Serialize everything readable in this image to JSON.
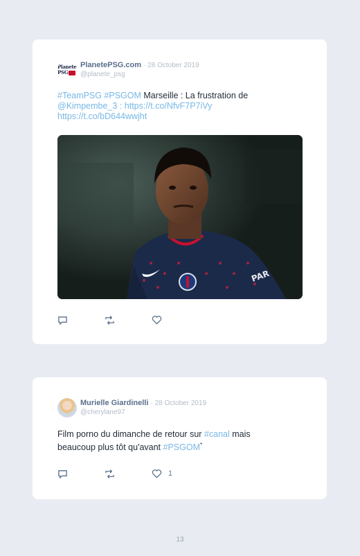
{
  "tweets": [
    {
      "name": "PlanetePSG.com",
      "date": "· 28 October 2019",
      "handle": "@planete_psg",
      "avatar_logo_text": [
        "Planete",
        "PSG"
      ],
      "text_segments": [
        {
          "text": "#TeamPSG",
          "link": true
        },
        {
          "text": " ",
          "link": false
        },
        {
          "text": "#PSGOM",
          "link": true
        },
        {
          "text": " Marseille : La frustration de ",
          "link": false
        },
        {
          "text": "@Kimpembe_3",
          "link": true
        },
        {
          "text": " : ",
          "link": false
        },
        {
          "text": "https://t.co/NfvF7P7iVy",
          "link": true
        },
        {
          "text": " ",
          "link": false
        },
        {
          "text": "https://t.co/bD644wwjht",
          "link": true
        }
      ],
      "has_media": true,
      "media_alt_text_visible": "PAR",
      "like_count": ""
    },
    {
      "name": "Murielle Giardinelli",
      "date": "· 28 October 2019",
      "handle": "@cherylane97",
      "text_segments": [
        {
          "text": "Film porno du dimanche de retour sur ",
          "link": false
        },
        {
          "text": "#canal",
          "link": true
        },
        {
          "text": " mais beaucoup plus tôt qu'avant ",
          "link": false
        },
        {
          "text": "#PSGOM",
          "link": true
        },
        {
          "text": "*",
          "link": false
        }
      ],
      "has_media": false,
      "like_count": "1"
    }
  ],
  "icons": [
    "reply-icon",
    "retweet-icon",
    "like-icon"
  ],
  "colors": {
    "link": "#77b7e6",
    "name": "#5a6f8c",
    "meta": "#b3bcc8",
    "background": "#e8ecf2",
    "psg_red": "#c8102e",
    "psg_navy": "#1b2a49"
  },
  "page_number": "13"
}
